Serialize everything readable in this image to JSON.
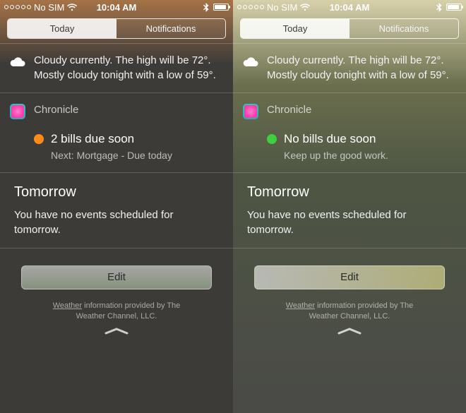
{
  "status": {
    "carrier": "No SIM",
    "time": "10:04 AM"
  },
  "tabs": {
    "today": "Today",
    "notifications": "Notifications"
  },
  "weather": {
    "text": "Cloudy currently. The high will be 72°. Mostly cloudy tonight with a low of 59°."
  },
  "widget": {
    "app_name": "Chronicle"
  },
  "tomorrow": {
    "heading": "Tomorrow",
    "text": "You have no events scheduled for tomorrow."
  },
  "edit_label": "Edit",
  "footer": {
    "link": "Weather",
    "rest": " information provided by The Weather Channel, LLC."
  },
  "screens": {
    "left": {
      "dot_color": "#ff8c1a",
      "line1": "2 bills due soon",
      "line2": "Next: Mortgage - Due today"
    },
    "right": {
      "dot_color": "#3fcf3f",
      "line1": "No bills due soon",
      "line2": "Keep up the good work."
    }
  }
}
